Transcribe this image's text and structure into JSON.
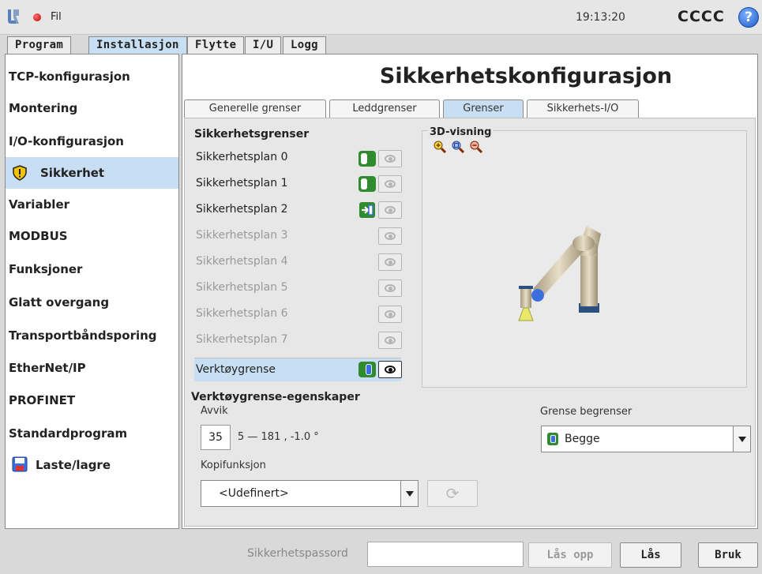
{
  "topbar": {
    "menu_label": "Fil",
    "time": "19:13:20",
    "robot_name": "CCCC",
    "help_symbol": "?",
    "logo_icon": "ur-logo-icon",
    "status_color": "#d00000"
  },
  "main_tabs": [
    {
      "label": "Program"
    },
    {
      "label": "Installasjon"
    },
    {
      "label": "Flytte"
    },
    {
      "label": "I/U"
    },
    {
      "label": "Logg"
    }
  ],
  "sidebar": {
    "items": [
      {
        "label": "TCP-konfigurasjon"
      },
      {
        "label": "Montering"
      },
      {
        "label": "I/O-konfigurasjon"
      },
      {
        "label": "Sikkerhet",
        "icon": "shield-icon"
      },
      {
        "label": "Variabler"
      },
      {
        "label": "MODBUS"
      },
      {
        "label": "Funksjoner"
      },
      {
        "label": "Glatt overgang"
      },
      {
        "label": "Transportbåndsporing"
      },
      {
        "label": "EtherNet/IP"
      },
      {
        "label": "PROFINET"
      },
      {
        "label": "Standardprogram"
      },
      {
        "label": "Laste/lagre",
        "icon": "disk-icon"
      }
    ]
  },
  "content": {
    "title": "Sikkerhetskonfigurasjon",
    "sub_tabs": [
      {
        "label": "Generelle grenser"
      },
      {
        "label": "Leddgrenser"
      },
      {
        "label": "Grenser"
      },
      {
        "label": "Sikkerhets-I/O"
      }
    ],
    "limits_heading": "Sikkerhetsgrenser",
    "planes": [
      {
        "label": "Sikkerhetsplan 0"
      },
      {
        "label": "Sikkerhetsplan 1"
      },
      {
        "label": "Sikkerhetsplan 2"
      },
      {
        "label": "Sikkerhetsplan 3"
      },
      {
        "label": "Sikkerhetsplan 4"
      },
      {
        "label": "Sikkerhetsplan 5"
      },
      {
        "label": "Sikkerhetsplan 6"
      },
      {
        "label": "Sikkerhetsplan 7"
      }
    ],
    "tool_limit_label": "Verktøygrense",
    "view_label": "3D-visning",
    "props_heading": "Verktøygrense-egenskaper",
    "deviation_label": "Avvik",
    "deviation_value": "35",
    "deviation_range": "5 — 181 , -1.0 °",
    "limit_restrict_label": "Grense begrenser",
    "limit_restrict_value": "Begge",
    "copy_label": "Kopifunksjon",
    "copy_value": "<Udefinert>"
  },
  "bottom": {
    "password_label": "Sikkerhetspassord",
    "password_value": "",
    "unlock_label": "Lås opp",
    "lock_label": "Lås",
    "apply_label": "Bruk"
  },
  "colors": {
    "accent": "#c8dff3",
    "toggle_on": "#2e8b2e",
    "toggle_blue": "#3a6fdc"
  }
}
